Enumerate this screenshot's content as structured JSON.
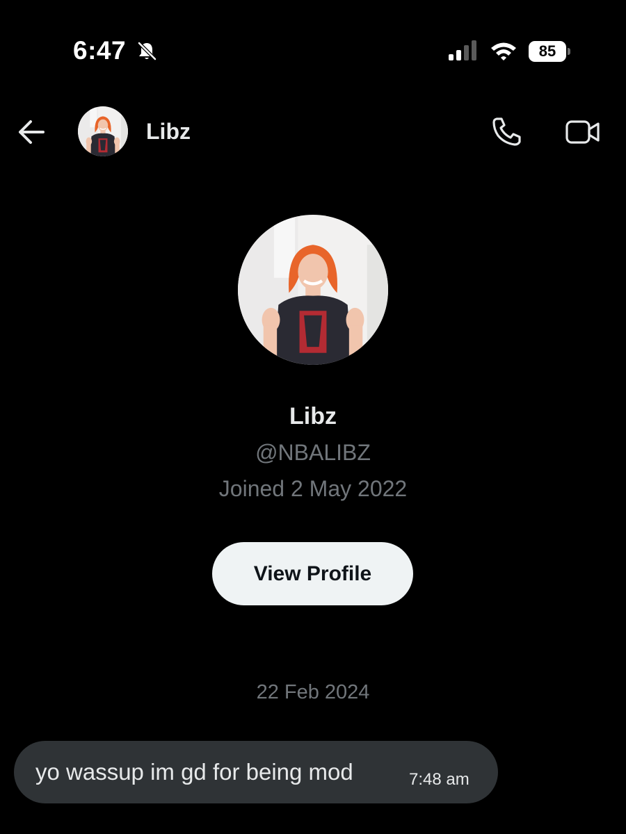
{
  "status_bar": {
    "time": "6:47",
    "battery": "85",
    "icons": [
      "bell-slash-icon",
      "cellular-signal-icon",
      "wifi-icon",
      "battery-icon"
    ]
  },
  "header": {
    "back_icon": "arrow-left-icon",
    "name": "Libz",
    "call_icon": "phone-icon",
    "video_icon": "video-camera-icon"
  },
  "profile": {
    "name": "Libz",
    "handle": "@NBALIBZ",
    "joined": "Joined 2 May 2022",
    "view_profile_label": "View Profile"
  },
  "conversation": {
    "date_separator": "22 Feb 2024",
    "messages": [
      {
        "text": "yo wassup im gd for being mod",
        "time": "7:48 am"
      }
    ]
  },
  "colors": {
    "background": "#000000",
    "text_primary": "#e7e9ea",
    "text_secondary": "#71767b",
    "bubble": "#2f3336",
    "button": "#eff3f4",
    "avatar_hair": "#e8652a"
  }
}
